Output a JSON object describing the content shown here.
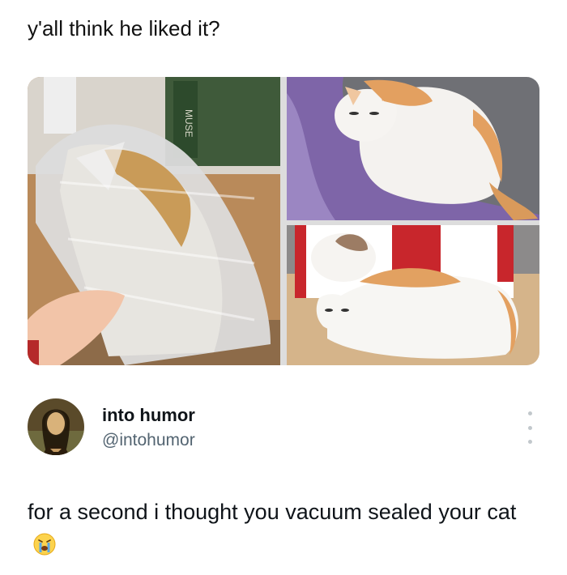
{
  "post": {
    "caption": "y'all think he liked it?"
  },
  "media": [
    {
      "icon": "vacuum-sealed-cat-photo",
      "box_text": "MUSE"
    },
    {
      "icon": "cat-on-blanket-photo"
    },
    {
      "icon": "cat-in-box-photo"
    }
  ],
  "author": {
    "display_name": "into humor",
    "handle": "@intohumor",
    "avatar_icon": "mona-lisa-avatar"
  },
  "more_icon": "more-options-icon",
  "tweet": {
    "text": "for a second i thought you vacuum sealed your cat",
    "emoji_icon": "loudly-crying-face-emoji"
  },
  "colors": {
    "text": "#0f1419",
    "handle": "#536471",
    "dots": "#c2c8cc"
  }
}
